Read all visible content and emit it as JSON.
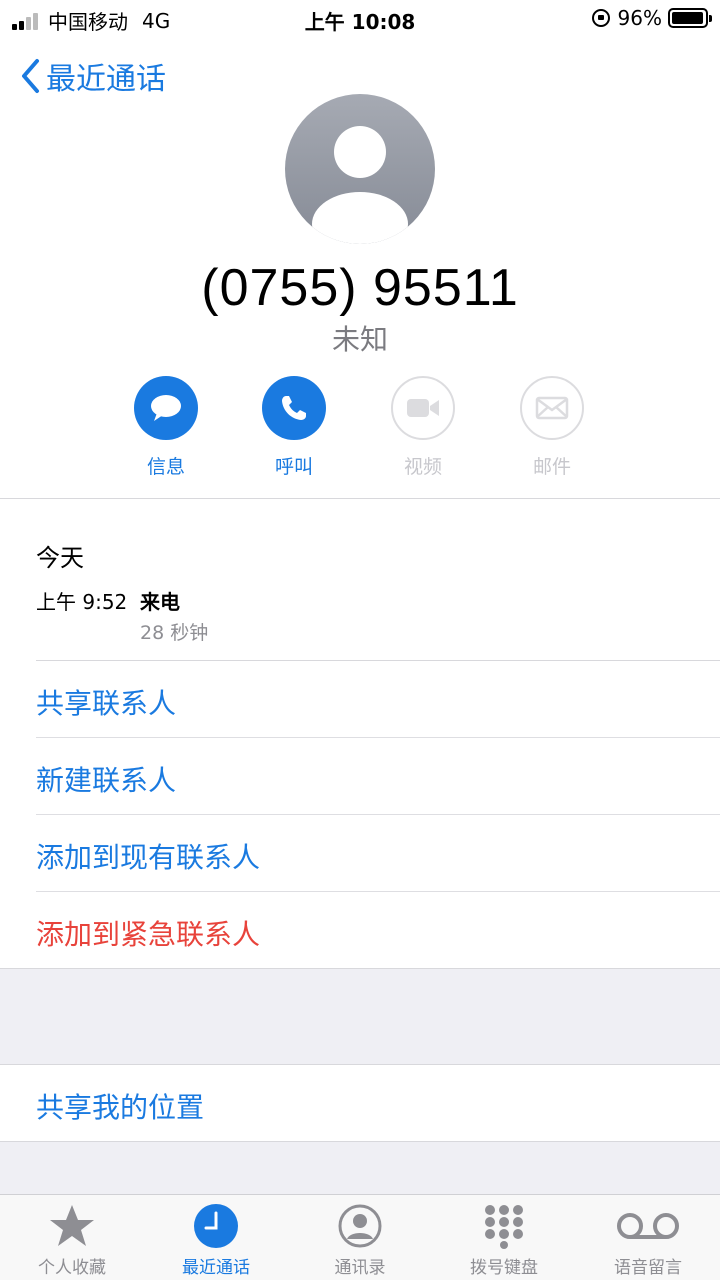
{
  "status_bar": {
    "carrier": "中国移动",
    "network": "4G",
    "time": "上午 10:08",
    "battery": "96%",
    "battery_level": 0.96
  },
  "nav": {
    "back_label": "最近通话"
  },
  "contact": {
    "number": "(0755) 95511",
    "label": "未知"
  },
  "actions": [
    {
      "label": "信息",
      "icon": "message-icon",
      "enabled": true
    },
    {
      "label": "呼叫",
      "icon": "phone-icon",
      "enabled": true
    },
    {
      "label": "视频",
      "icon": "video-icon",
      "enabled": false
    },
    {
      "label": "邮件",
      "icon": "mail-icon",
      "enabled": false
    }
  ],
  "history": {
    "day": "今天",
    "entries": [
      {
        "time": "上午 9:52",
        "type": "来电",
        "duration": "28 秒钟"
      }
    ]
  },
  "menu": {
    "share_contact": "共享联系人",
    "new_contact": "新建联系人",
    "add_existing": "添加到现有联系人",
    "add_emergency": "添加到紧急联系人",
    "share_location": "共享我的位置"
  },
  "tabs": [
    {
      "label": "个人收藏",
      "icon": "star-icon",
      "active": false
    },
    {
      "label": "最近通话",
      "icon": "clock-icon",
      "active": true
    },
    {
      "label": "通讯录",
      "icon": "contacts-icon",
      "active": false
    },
    {
      "label": "拨号键盘",
      "icon": "keypad-icon",
      "active": false
    },
    {
      "label": "语音留言",
      "icon": "voicemail-icon",
      "active": false
    }
  ],
  "colors": {
    "accent": "#1a7ae0",
    "destructive": "#e8433b",
    "secondary_text": "#8e8e93"
  }
}
